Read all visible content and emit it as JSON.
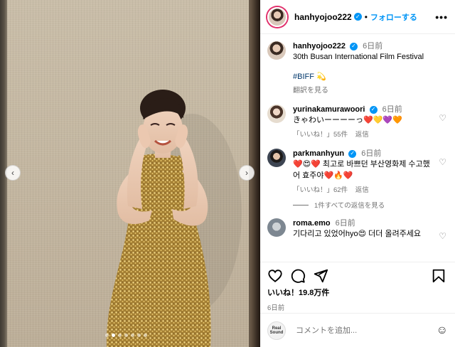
{
  "post": {
    "username": "hanhyojoo222",
    "separator": "•",
    "follow_label": "フォローする",
    "more_label": "•••",
    "caption": {
      "username": "hanhyojoo222",
      "time": "6日前",
      "text": "30th Busan International Film Festival",
      "hashtag": "#BIFF",
      "hashtag_emoji": "💫",
      "translate_label": "翻訳を見る"
    },
    "carousel": {
      "prev_label": "‹",
      "next_label": "›",
      "dot_count": 7,
      "active_dot": 1
    }
  },
  "comments": [
    {
      "username": "yurinakamurawoori",
      "time": "6日前",
      "text": "きゃわいーーーーっ❤️💛💜🧡",
      "likes": "「いいね！」55件",
      "reply_label": "返信"
    },
    {
      "username": "parkmanhyun",
      "time": "6日前",
      "text": "❤️😍❤️ 최고로 바쁘던 부산영화제 수고했어 효주야❤️🔥❤️",
      "likes": "「いいね！」62件",
      "reply_label": "返信",
      "view_replies": "1件すべての返信を見る"
    },
    {
      "username": "roma.emo",
      "time": "6日前",
      "text": "기다리고 있었어hyo😍 더더 올려주세요"
    }
  ],
  "actions": {
    "likes_text": "いいね！19.8万件",
    "date": "6日前"
  },
  "compose": {
    "avatar_text_1": "Real",
    "avatar_text_2": "Sound",
    "placeholder": "コメントを追加..."
  },
  "colors": {
    "accent": "#0095f6",
    "muted": "#737373",
    "dress_gold": "#b8923e"
  }
}
